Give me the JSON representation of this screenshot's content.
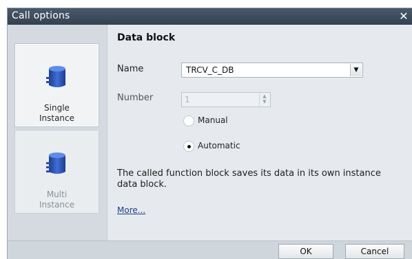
{
  "window": {
    "title": "Call options",
    "close_glyph": "✕"
  },
  "instance_options": [
    {
      "label_line1": "Single",
      "label_line2": "Instance",
      "icon": "database-stack-icon",
      "selected": true
    },
    {
      "label_line1": "Multi",
      "label_line2": "Instance",
      "icon": "database-stack-icon",
      "selected": false
    }
  ],
  "data_block": {
    "heading": "Data block",
    "name_label": "Name",
    "name_value": "TRCV_C_DB",
    "number_label": "Number",
    "number_value": "1",
    "radio_manual": "Manual",
    "radio_automatic": "Automatic",
    "selected_mode": "Automatic"
  },
  "description": "The called function block saves its data in its own instance data block.",
  "more_link": "More...",
  "buttons": {
    "ok": "OK",
    "cancel": "Cancel"
  },
  "colors": {
    "accent": "#2a5db0",
    "title_bar": "#3c4a59"
  }
}
